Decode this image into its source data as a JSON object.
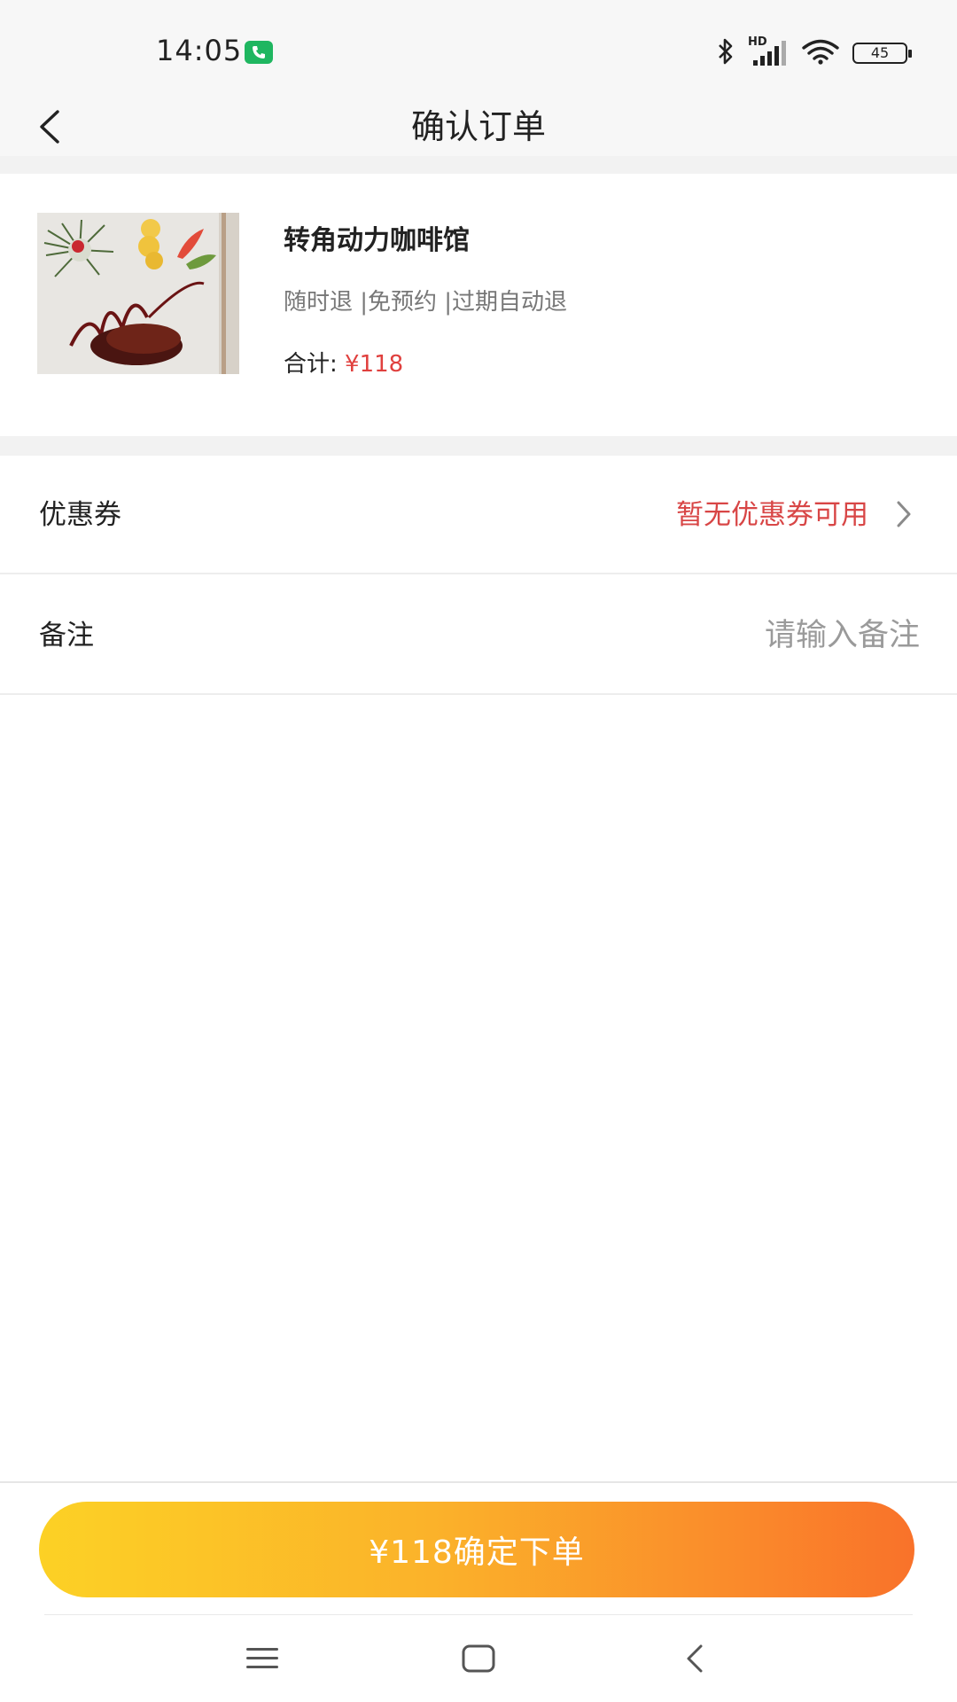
{
  "status_bar": {
    "time": "14:05",
    "battery": "45",
    "network": "HD"
  },
  "header": {
    "title": "确认订单"
  },
  "product": {
    "shop_name": "转角动力咖啡馆",
    "tags": "随时退 |免预约 |过期自动退",
    "total_label": "合计:",
    "total_price": "¥118"
  },
  "coupon": {
    "label": "优惠券",
    "value": "暂无优惠券可用"
  },
  "remark": {
    "label": "备注",
    "placeholder": "请输入备注"
  },
  "submit": {
    "label": "¥118确定下单"
  },
  "colors": {
    "accent_red": "#d84646",
    "button_gradient_start": "#fcd125",
    "button_gradient_end": "#f9722a",
    "call_badge": "#1fb660"
  },
  "icons": {
    "back": "chevron-left-icon",
    "coupon_arrow": "chevron-right-icon",
    "sys_menu": "menu-icon",
    "sys_home": "home-square-icon",
    "sys_back": "back-triangle-icon"
  }
}
